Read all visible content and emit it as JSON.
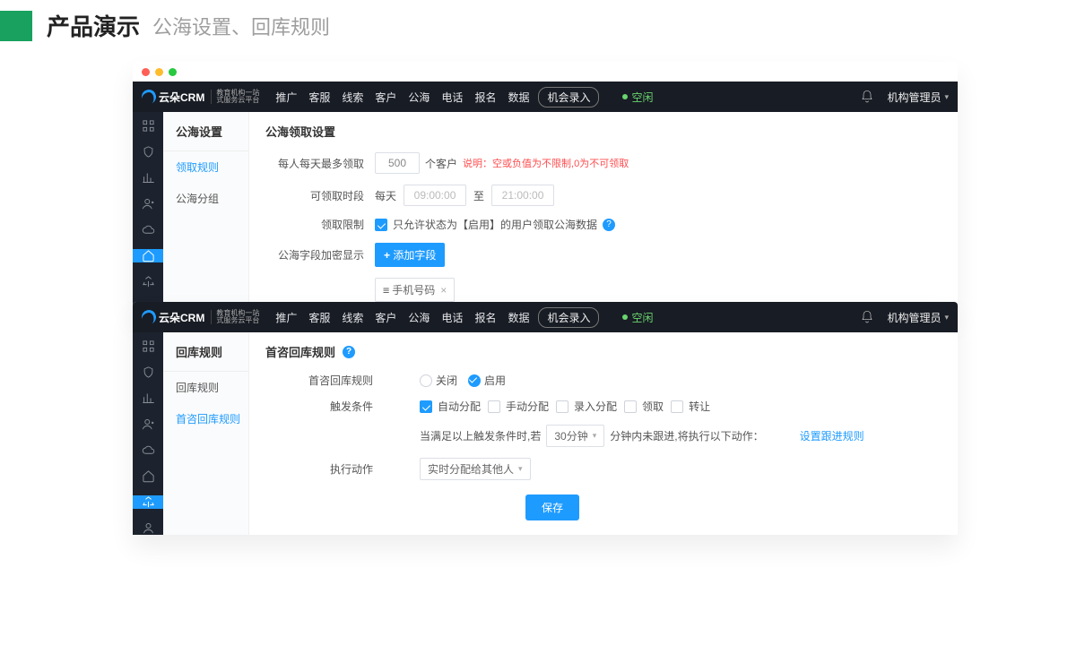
{
  "header": {
    "title": "产品演示",
    "subtitle": "公海设置、回库规则"
  },
  "logo": {
    "text": "云朵CRM",
    "sub1": "教育机构一站",
    "sub2": "式服务云平台"
  },
  "topnav": [
    "推广",
    "客服",
    "线索",
    "客户",
    "公海",
    "电话",
    "报名",
    "数据"
  ],
  "topbtn": "机会录入",
  "idle": "空闲",
  "account": "机构管理员",
  "panelA": {
    "sidebar_title": "公海设置",
    "sidebar_items": [
      "领取规则",
      "公海分组"
    ],
    "section": "公海领取设置",
    "r1_label": "每人每天最多领取",
    "r1_value": "500",
    "r1_unit": "个客户",
    "r1_hint_pre": "说明：",
    "r1_hint": "空或负值为不限制,0为不可领取",
    "r2_label": "可领取时段",
    "r2_every": "每天",
    "r2_from": "09:00:00",
    "r2_to_word": "至",
    "r2_to": "21:00:00",
    "r3_label": "领取限制",
    "r3_text": "只允许状态为【启用】的用户领取公海数据",
    "r4_label": "公海字段加密显示",
    "r4_btn": "添加字段",
    "r4_tag": "手机号码"
  },
  "panelB": {
    "sidebar_title": "回库规则",
    "sidebar_items": [
      "回库规则",
      "首咨回库规则"
    ],
    "section": "首咨回库规则",
    "r1_label": "首咨回库规则",
    "opt_off": "关闭",
    "opt_on": "启用",
    "r2_label": "触发条件",
    "cb": [
      "自动分配",
      "手动分配",
      "录入分配",
      "领取",
      "转让"
    ],
    "sentence_a": "当满足以上触发条件时,若",
    "sel_time": "30分钟",
    "sentence_b": "分钟内未跟进,将执行以下动作：",
    "link": "设置跟进规则",
    "r3_label": "执行动作",
    "sel_action": "实时分配给其他人",
    "save": "保存"
  }
}
